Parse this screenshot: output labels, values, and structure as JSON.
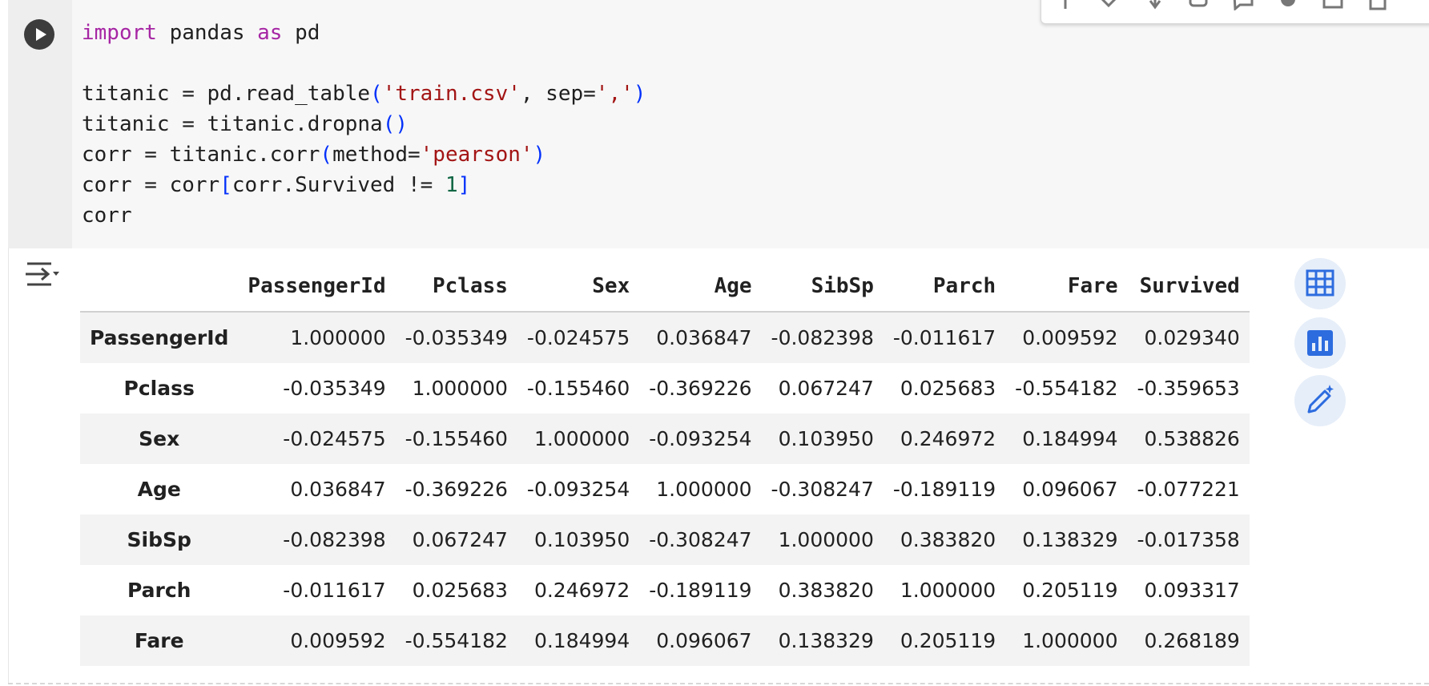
{
  "code": {
    "lines": [
      [
        [
          "kw",
          "import"
        ],
        [
          "t",
          " pandas "
        ],
        [
          "kw",
          "as"
        ],
        [
          "t",
          " pd"
        ]
      ],
      [],
      [
        [
          "t",
          "titanic = pd.read_table"
        ],
        [
          "paren",
          "("
        ],
        [
          "str",
          "'train.csv'"
        ],
        [
          "t",
          ", sep="
        ],
        [
          "str",
          "','"
        ],
        [
          "paren",
          ")"
        ]
      ],
      [
        [
          "t",
          "titanic = titanic.dropna"
        ],
        [
          "paren",
          "()"
        ]
      ],
      [
        [
          "t",
          "corr = titanic.corr"
        ],
        [
          "paren",
          "("
        ],
        [
          "t",
          "method="
        ],
        [
          "str",
          "'pearson'"
        ],
        [
          "paren",
          ")"
        ]
      ],
      [
        [
          "t",
          "corr = corr"
        ],
        [
          "paren",
          "["
        ],
        [
          "t",
          "corr.Survived != "
        ],
        [
          "num",
          "1"
        ],
        [
          "paren",
          "]"
        ]
      ],
      [
        [
          "t",
          "corr"
        ]
      ]
    ]
  },
  "table": {
    "columns": [
      "PassengerId",
      "Pclass",
      "Sex",
      "Age",
      "SibSp",
      "Parch",
      "Fare",
      "Survived"
    ],
    "rows": [
      {
        "label": "PassengerId",
        "values": [
          "1.000000",
          "-0.035349",
          "-0.024575",
          "0.036847",
          "-0.082398",
          "-0.011617",
          "0.009592",
          "0.029340"
        ]
      },
      {
        "label": "Pclass",
        "values": [
          "-0.035349",
          "1.000000",
          "-0.155460",
          "-0.369226",
          "0.067247",
          "0.025683",
          "-0.554182",
          "-0.359653"
        ]
      },
      {
        "label": "Sex",
        "values": [
          "-0.024575",
          "-0.155460",
          "1.000000",
          "-0.093254",
          "0.103950",
          "0.246972",
          "0.184994",
          "0.538826"
        ]
      },
      {
        "label": "Age",
        "values": [
          "0.036847",
          "-0.369226",
          "-0.093254",
          "1.000000",
          "-0.308247",
          "-0.189119",
          "0.096067",
          "-0.077221"
        ]
      },
      {
        "label": "SibSp",
        "values": [
          "-0.082398",
          "0.067247",
          "0.103950",
          "-0.308247",
          "1.000000",
          "0.383820",
          "0.138329",
          "-0.017358"
        ]
      },
      {
        "label": "Parch",
        "values": [
          "-0.011617",
          "0.025683",
          "0.246972",
          "-0.189119",
          "0.383820",
          "1.000000",
          "0.205119",
          "0.093317"
        ]
      },
      {
        "label": "Fare",
        "values": [
          "0.009592",
          "-0.554182",
          "0.184994",
          "0.096067",
          "0.138329",
          "0.205119",
          "1.000000",
          "0.268189"
        ]
      }
    ]
  },
  "icons": {
    "run": "play-icon",
    "output_toggle": "output-menu-icon",
    "side_buttons": [
      "table-icon",
      "chart-icon",
      "magic-edit-icon"
    ],
    "toolbar": [
      "move-up-icon",
      "move-down-icon",
      "link-icon",
      "copy-icon",
      "comment-icon",
      "settings-icon",
      "open-in-tab-icon",
      "delete-icon"
    ]
  },
  "colors": {
    "keyword": "#a626a4",
    "string": "#a31515",
    "number": "#116644",
    "bracket": "#0431fa",
    "accent": "#2d6cdf"
  }
}
